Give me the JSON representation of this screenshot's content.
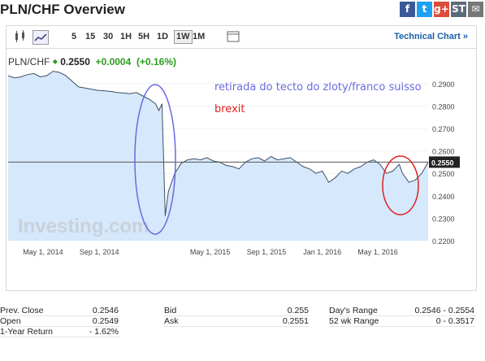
{
  "title": "PLN/CHF Overview",
  "share_icons": [
    {
      "name": "facebook-icon",
      "glyph": "f",
      "color": "#3b5998"
    },
    {
      "name": "twitter-icon",
      "glyph": "t",
      "color": "#1da1f2"
    },
    {
      "name": "google-plus-icon",
      "glyph": "g+",
      "color": "#dd4b39"
    },
    {
      "name": "stocktwits-icon",
      "glyph": "ST",
      "color": "#5a6b7c"
    },
    {
      "name": "email-icon",
      "glyph": "✉",
      "color": "#777777"
    }
  ],
  "toolbar": {
    "timeframes": [
      "5",
      "15",
      "30",
      "1H",
      "5H",
      "1D",
      "1W",
      "1M"
    ],
    "active_timeframe": "1W",
    "technical_chart": "Technical Chart »"
  },
  "quote": {
    "pair": "PLN/CHF",
    "price": "0.2550",
    "change": "+0.0004",
    "change_pct": "(+0.16%)"
  },
  "annotations": {
    "blue_text": "retirada do tecto do zloty/franco suisso",
    "red_text": "brexit",
    "blue_color": "#6a6ae0",
    "red_color": "#e02020"
  },
  "watermark": "Investing.com",
  "chart_data": {
    "type": "area",
    "x_tick_labels": [
      "May 1, 2014",
      "Sep 1, 2014",
      "May 1, 2015",
      "Sep 1, 2015",
      "Jan 1, 2016",
      "May 1, 2016"
    ],
    "y_tick_labels": [
      "0.2900",
      "0.2800",
      "0.2700",
      "0.2600",
      "0.2500",
      "0.2400",
      "0.2300",
      "0.2200"
    ],
    "ylim": [
      0.22,
      0.295
    ],
    "current_price_label": "0.2550",
    "current_price": 0.255,
    "series": [
      {
        "x": [
          "2014-02-14",
          "2014-02-28",
          "2014-03-14",
          "2014-03-28",
          "2014-04-11",
          "2014-04-25",
          "2014-05-09",
          "2014-05-23",
          "2014-06-06",
          "2014-06-20",
          "2014-07-04",
          "2014-07-18",
          "2014-08-01",
          "2014-08-15",
          "2014-08-29",
          "2014-09-12",
          "2014-09-26",
          "2014-10-10",
          "2014-10-24",
          "2014-11-07",
          "2014-11-21",
          "2014-12-05",
          "2014-12-19",
          "2015-01-02",
          "2015-01-09",
          "2015-01-16",
          "2015-01-23",
          "2015-01-30",
          "2015-02-13",
          "2015-02-27",
          "2015-03-13",
          "2015-03-27",
          "2015-04-10",
          "2015-04-24",
          "2015-05-08",
          "2015-05-22",
          "2015-06-05",
          "2015-06-19",
          "2015-07-03",
          "2015-07-17",
          "2015-07-31",
          "2015-08-14",
          "2015-08-28",
          "2015-09-11",
          "2015-09-25",
          "2015-10-09",
          "2015-10-23",
          "2015-11-06",
          "2015-11-20",
          "2015-12-04",
          "2015-12-18",
          "2016-01-01",
          "2016-01-15",
          "2016-01-29",
          "2016-02-12",
          "2016-02-26",
          "2016-03-11",
          "2016-03-25",
          "2016-04-08",
          "2016-04-22",
          "2016-05-06",
          "2016-05-20",
          "2016-06-03",
          "2016-06-17",
          "2016-06-24",
          "2016-07-08",
          "2016-07-22",
          "2016-08-05",
          "2016-08-19"
        ],
        "y": [
          0.2935,
          0.2925,
          0.293,
          0.294,
          0.2945,
          0.293,
          0.2935,
          0.2955,
          0.295,
          0.2935,
          0.291,
          0.2885,
          0.288,
          0.2875,
          0.287,
          0.2868,
          0.2865,
          0.286,
          0.2858,
          0.2855,
          0.286,
          0.2845,
          0.283,
          0.281,
          0.278,
          0.281,
          0.231,
          0.242,
          0.25,
          0.2545,
          0.256,
          0.2565,
          0.256,
          0.257,
          0.2555,
          0.255,
          0.2535,
          0.253,
          0.252,
          0.255,
          0.2565,
          0.257,
          0.2555,
          0.2575,
          0.256,
          0.2565,
          0.257,
          0.255,
          0.253,
          0.252,
          0.25,
          0.251,
          0.246,
          0.248,
          0.251,
          0.25,
          0.252,
          0.253,
          0.255,
          0.256,
          0.254,
          0.25,
          0.251,
          0.254,
          0.25,
          0.246,
          0.247,
          0.25,
          0.255
        ]
      }
    ]
  },
  "stats": [
    {
      "label": "Prev. Close",
      "value": "0.2546"
    },
    {
      "label": "Open",
      "value": "0.2549"
    },
    {
      "label": "1-Year Return",
      "value": "- 1.62%"
    },
    {
      "label": "Bid",
      "value": "0.255"
    },
    {
      "label": "Ask",
      "value": "0.2551"
    },
    {
      "label": "Day's Range",
      "value": "0.2546 - 0.2554"
    },
    {
      "label": "52 wk Range",
      "value": "0 - 0.3517"
    }
  ]
}
